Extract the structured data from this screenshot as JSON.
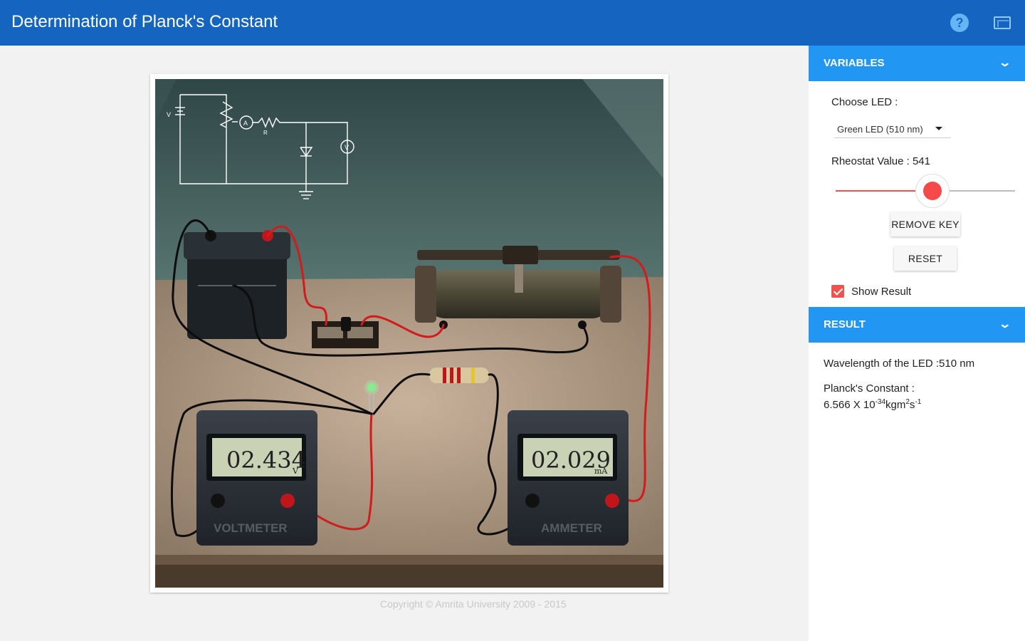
{
  "header": {
    "title": "Determination of Planck's Constant",
    "help_icon": "?",
    "fullscreen_icon": "fullscreen-icon"
  },
  "variables": {
    "heading": "VARIABLES",
    "choose_led_label": "Choose LED :",
    "led_selected": "Green LED (510 nm)",
    "rheostat_label": "Rheostat Value : 541",
    "rheostat_value": 541,
    "remove_key_label": "REMOVE KEY",
    "reset_label": "RESET",
    "show_result_label": "Show Result",
    "show_result_checked": true
  },
  "result": {
    "heading": "RESULT",
    "wavelength_text": "Wavelength of the LED :510 nm",
    "planck_label": "Planck's Constant :",
    "planck_mantissa": "6.566 X 10",
    "planck_exp": "-34",
    "planck_unit": "kgm",
    "planck_unit_exp": "2",
    "planck_unit2": "s",
    "planck_unit2_exp": "-1"
  },
  "simulation": {
    "voltmeter_reading": "02.434",
    "voltmeter_unit": "V",
    "voltmeter_label": "VOLTMETER",
    "ammeter_reading": "02.029",
    "ammeter_unit": "mA",
    "ammeter_label": "AMMETER",
    "circuit_labels": {
      "v": "V",
      "a": "A",
      "r": "R",
      "vm": "V"
    }
  },
  "footer": {
    "copyright": "Copyright © Amrita University 2009 - 2015"
  },
  "colors": {
    "header": "#1565c0",
    "panel_head": "#2196f3",
    "accent": "#f44a4a"
  }
}
